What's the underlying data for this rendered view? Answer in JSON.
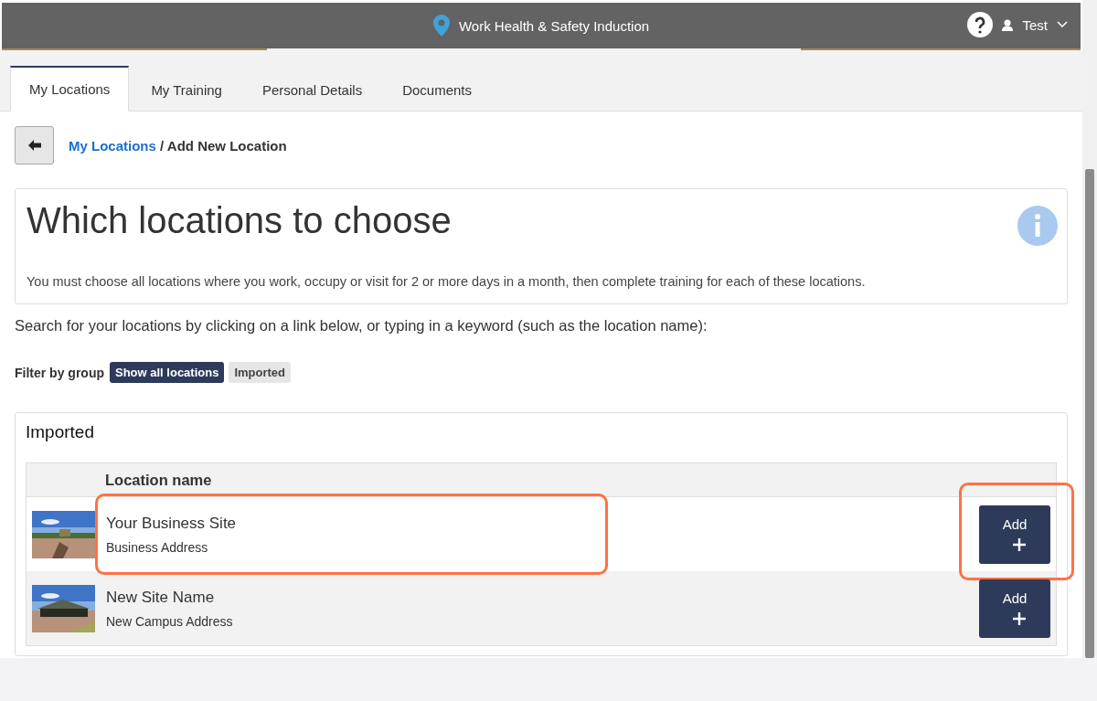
{
  "header": {
    "title": "Work Health & Safety Induction",
    "user": "Test"
  },
  "tabs": [
    {
      "label": "My Locations",
      "selected": true
    },
    {
      "label": "My Training",
      "selected": false
    },
    {
      "label": "Personal Details",
      "selected": false
    },
    {
      "label": "Documents",
      "selected": false
    }
  ],
  "breadcrumb": {
    "link": "My Locations",
    "current": "/ Add New Location"
  },
  "info_card": {
    "title": "Which locations to choose",
    "text": "You must choose all locations where you work, occupy or visit for 2 or more days in a month, then complete training for each of these locations."
  },
  "search_hint": "Search for your locations by clicking on a link below, or typing in a keyword (such as the location name):",
  "filter": {
    "label": "Filter by group",
    "options": [
      {
        "label": "Show all locations",
        "selected": true
      },
      {
        "label": "Imported",
        "selected": false
      }
    ]
  },
  "group": {
    "title": "Imported",
    "table": {
      "columns": [
        "Location name"
      ],
      "rows": [
        {
          "name": "Your Business Site",
          "address": "Business Address",
          "button": "Add",
          "highlighted": true,
          "button_highlighted": true
        },
        {
          "name": "New Site Name",
          "address": "New Campus Address",
          "button": "Add",
          "highlighted": false,
          "button_highlighted": false
        }
      ]
    }
  }
}
